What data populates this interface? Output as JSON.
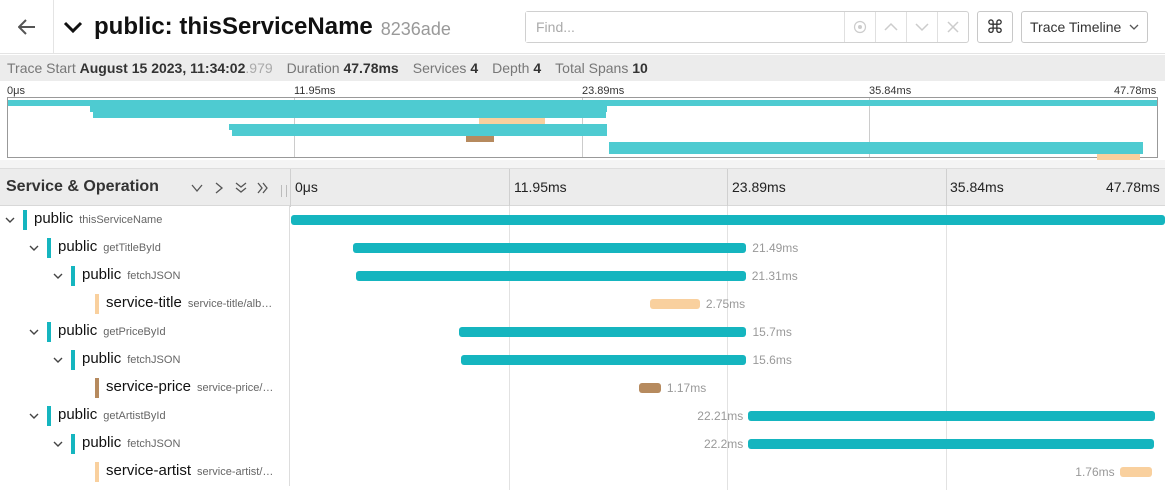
{
  "header": {
    "title": "public: thisServiceName",
    "trace_id": "8236ade",
    "find_placeholder": "Find...",
    "view_mode": "Trace Timeline",
    "shortcut_glyph": "⌘"
  },
  "stats": {
    "trace_start_label": "Trace Start",
    "trace_start_value": "August 15 2023, 11:34:02",
    "trace_start_ms": ".979",
    "duration_label": "Duration",
    "duration_value": "47.78ms",
    "services_label": "Services",
    "services_value": "4",
    "depth_label": "Depth",
    "depth_value": "4",
    "total_spans_label": "Total Spans",
    "total_spans_value": "10"
  },
  "minimap": {
    "ticks": [
      "0μs",
      "11.95ms",
      "23.89ms",
      "35.84ms",
      "47.78ms"
    ]
  },
  "timeline": {
    "left_title": "Service & Operation",
    "ticks": [
      "0μs",
      "11.95ms",
      "23.89ms",
      "35.84ms",
      "47.78ms"
    ],
    "total_ms": 47.78,
    "spans": [
      {
        "depth": 0,
        "service": "public",
        "operation": "thisServiceName",
        "color": "#15b5bf",
        "start_ms": 0,
        "duration_ms": 47.78,
        "duration_label": "",
        "label_side": "none",
        "expanded": true
      },
      {
        "depth": 1,
        "service": "public",
        "operation": "getTitleById",
        "color": "#15b5bf",
        "start_ms": 3.4,
        "duration_ms": 21.49,
        "duration_label": "21.49ms",
        "label_side": "right",
        "expanded": true
      },
      {
        "depth": 2,
        "service": "public",
        "operation": "fetchJSON",
        "color": "#15b5bf",
        "start_ms": 3.55,
        "duration_ms": 21.31,
        "duration_label": "21.31ms",
        "label_side": "right",
        "expanded": true
      },
      {
        "depth": 3,
        "service": "service-title",
        "operation": "service-title/alb…",
        "color": "#f9d09e",
        "start_ms": 19.6,
        "duration_ms": 2.75,
        "duration_label": "2.75ms",
        "label_side": "right",
        "expanded": null
      },
      {
        "depth": 1,
        "service": "public",
        "operation": "getPriceById",
        "color": "#15b5bf",
        "start_ms": 9.2,
        "duration_ms": 15.7,
        "duration_label": "15.7ms",
        "label_side": "right",
        "expanded": true
      },
      {
        "depth": 2,
        "service": "public",
        "operation": "fetchJSON",
        "color": "#15b5bf",
        "start_ms": 9.3,
        "duration_ms": 15.6,
        "duration_label": "15.6ms",
        "label_side": "right",
        "expanded": true
      },
      {
        "depth": 3,
        "service": "service-price",
        "operation": "service-price/…",
        "color": "#b68a5e",
        "start_ms": 19.05,
        "duration_ms": 1.17,
        "duration_label": "1.17ms",
        "label_side": "right",
        "expanded": null
      },
      {
        "depth": 1,
        "service": "public",
        "operation": "getArtistById",
        "color": "#15b5bf",
        "start_ms": 25.0,
        "duration_ms": 22.21,
        "duration_label": "22.21ms",
        "label_side": "left",
        "expanded": true
      },
      {
        "depth": 2,
        "service": "public",
        "operation": "fetchJSON",
        "color": "#15b5bf",
        "start_ms": 25.0,
        "duration_ms": 22.2,
        "duration_label": "22.2ms",
        "label_side": "left",
        "expanded": true
      },
      {
        "depth": 3,
        "service": "service-artist",
        "operation": "service-artist/…",
        "color": "#f9d09e",
        "start_ms": 45.3,
        "duration_ms": 1.76,
        "duration_label": "1.76ms",
        "label_side": "left",
        "expanded": null
      }
    ]
  },
  "colors": {
    "teal": "#15b5bf",
    "minimap_teal": "#4ecbd1",
    "light_orange": "#f9d09e",
    "brown": "#b68a5e"
  }
}
